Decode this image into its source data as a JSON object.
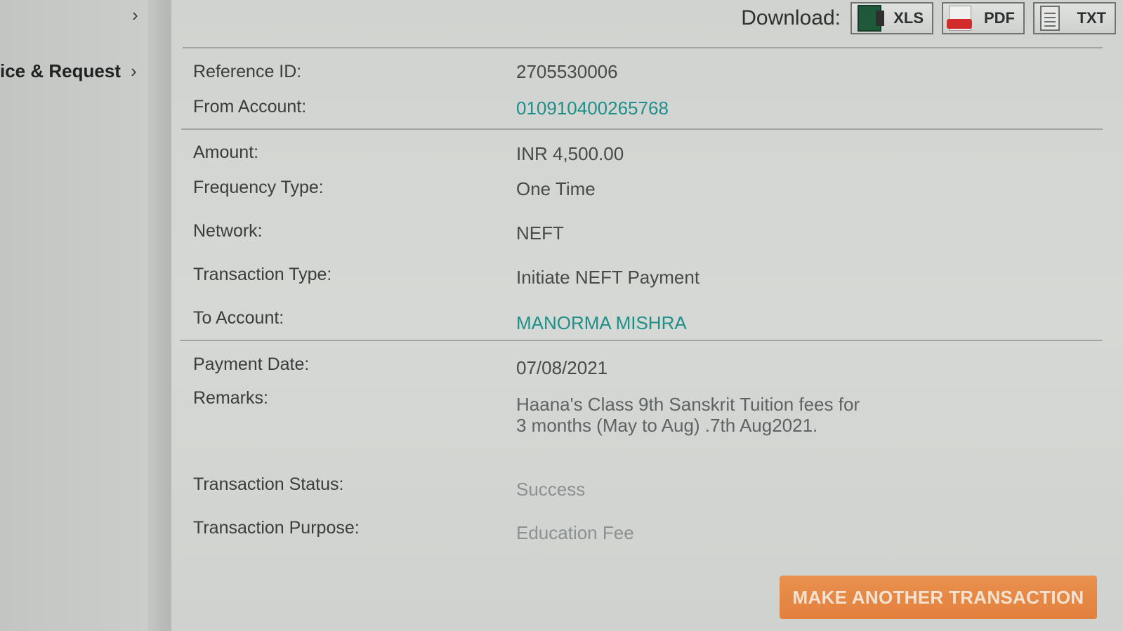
{
  "sidebar": {
    "item_label": "ice & Request"
  },
  "download": {
    "label": "Download:",
    "buttons": [
      {
        "label": "XLS",
        "icon": "excel-file-icon"
      },
      {
        "label": "PDF",
        "icon": "pdf-file-icon"
      },
      {
        "label": "TXT",
        "icon": "text-file-icon"
      }
    ]
  },
  "details": {
    "reference_id": {
      "label": "Reference ID:",
      "value": "2705530006"
    },
    "from_account": {
      "label": "From Account:",
      "value": "010910400265768"
    },
    "amount": {
      "label": "Amount:",
      "value": "INR 4,500.00"
    },
    "frequency_type": {
      "label": "Frequency Type:",
      "value": "One Time"
    },
    "network": {
      "label": "Network:",
      "value": "NEFT"
    },
    "transaction_type": {
      "label": "Transaction Type:",
      "value": "Initiate NEFT Payment"
    },
    "to_account": {
      "label": "To Account:",
      "value": "MANORMA MISHRA"
    },
    "payment_date": {
      "label": "Payment Date:",
      "value": "07/08/2021"
    },
    "remarks": {
      "label": "Remarks:",
      "value": "Haana's Class 9th Sanskrit Tuition fees for 3 months (May to Aug) .7th Aug2021."
    },
    "transaction_status": {
      "label": "Transaction Status:",
      "value": "Success"
    },
    "transaction_purpose": {
      "label": "Transaction Purpose:",
      "value": "Education Fee"
    }
  },
  "actions": {
    "make_another_label": "MAKE ANOTHER TRANSACTION"
  },
  "colors": {
    "accent_teal": "#1f8f89",
    "cta_orange": "#e3803d",
    "pdf_red": "#d22b2b",
    "xls_green": "#1e5a3a"
  }
}
